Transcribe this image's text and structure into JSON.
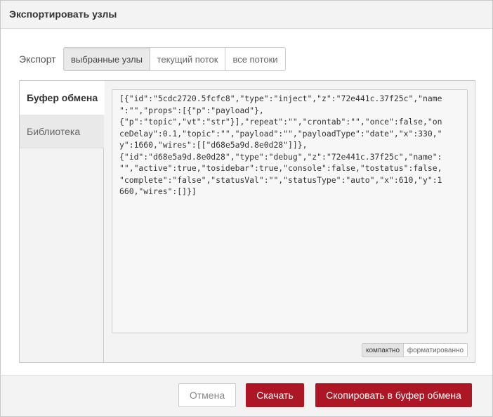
{
  "dialog": {
    "title": "Экспортировать узлы"
  },
  "export": {
    "label": "Экспорт",
    "options": [
      "выбранные узлы",
      "текущий поток",
      "все потоки"
    ],
    "selected": "выбранные узлы"
  },
  "sidebar": {
    "items": [
      "Буфер обмена",
      "Библиотека"
    ],
    "active": "Буфер обмена"
  },
  "clipboard": {
    "content": "[{\"id\":\"5cdc2720.5fcfc8\",\"type\":\"inject\",\"z\":\"72e441c.37f25c\",\"name\n\":\"\",\"props\":[{\"p\":\"payload\"},\n{\"p\":\"topic\",\"vt\":\"str\"}],\"repeat\":\"\",\"crontab\":\"\",\"once\":false,\"on\nceDelay\":0.1,\"topic\":\"\",\"payload\":\"\",\"payloadType\":\"date\",\"x\":330,\"\ny\":1660,\"wires\":[[\"d68e5a9d.8e0d28\"]]},\n{\"id\":\"d68e5a9d.8e0d28\",\"type\":\"debug\",\"z\":\"72e441c.37f25c\",\"name\":\n\"\",\"active\":true,\"tosidebar\":true,\"console\":false,\"tostatus\":false,\n\"complete\":\"false\",\"statusVal\":\"\",\"statusType\":\"auto\",\"x\":610,\"y\":1\n660,\"wires\":[]}]",
    "format_options": [
      "компактно",
      "форматированно"
    ],
    "format_selected": "компактно"
  },
  "footer": {
    "cancel_label": "Отмена",
    "download_label": "Скачать",
    "copy_label": "Скопировать в буфер обмена"
  },
  "colors": {
    "accent": "#ad1625",
    "header_bg": "#f3f3f3"
  }
}
